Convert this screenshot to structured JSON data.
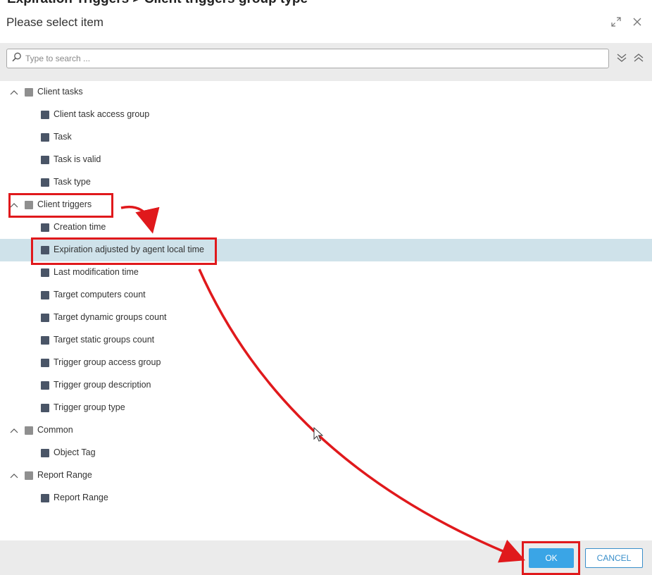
{
  "banner": "Expiration Triggers > Client triggers group type",
  "dialog": {
    "title": "Please select item",
    "expand_icon": "expand-diagonal-icon",
    "close_icon": "close-icon"
  },
  "search": {
    "placeholder": "Type to search ..."
  },
  "toolbar": {
    "expand_all_icon": "double-chevron-down-icon",
    "collapse_all_icon": "double-chevron-up-icon"
  },
  "tree": {
    "groups": [
      {
        "label": "Client tasks",
        "items": [
          "Client task access group",
          "Task",
          "Task is valid",
          "Task type"
        ]
      },
      {
        "label": "Client triggers",
        "items": [
          "Creation time",
          "Expiration adjusted by agent local time",
          "Last modification time",
          "Target computers count",
          "Target dynamic groups count",
          "Target static groups count",
          "Trigger group access group",
          "Trigger group description",
          "Trigger group type"
        ]
      },
      {
        "label": "Common",
        "items": [
          "Object Tag"
        ]
      },
      {
        "label": "Report Range",
        "items": [
          "Report Range"
        ]
      }
    ],
    "selected": "Expiration adjusted by agent local time"
  },
  "footer": {
    "ok_label": "OK",
    "cancel_label": "CANCEL"
  },
  "colors": {
    "highlight": "#e0191c",
    "selected_row": "#cfe2ea",
    "ok_button": "#3aa5e6",
    "panel_gray": "#ebebeb"
  }
}
